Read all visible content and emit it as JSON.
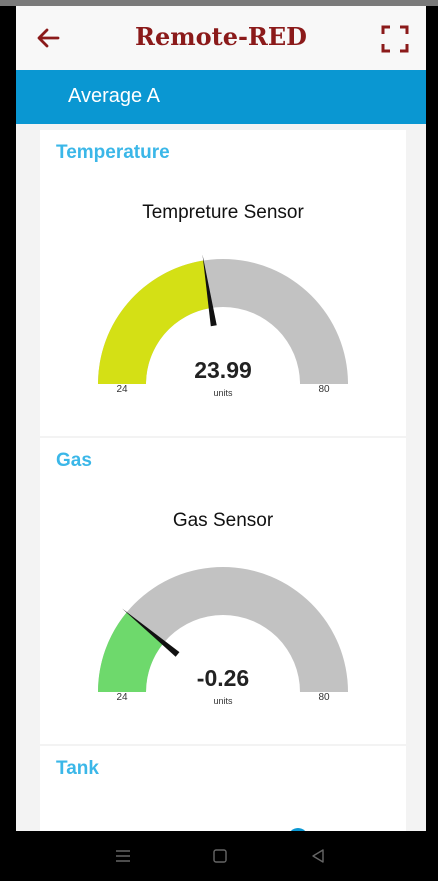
{
  "app": {
    "title": "Remote-RED"
  },
  "group": {
    "title": "Average A"
  },
  "cards": [
    {
      "label": "Temperature",
      "gauge": {
        "title": "Tempreture Sensor",
        "value": 23.99,
        "value_text": "23.99",
        "min": 24,
        "max": 80,
        "min_label": "24",
        "max_label": "80",
        "units": "units",
        "color": "#d4e015"
      }
    },
    {
      "label": "Gas",
      "gauge": {
        "title": "Gas Sensor",
        "value": -0.26,
        "value_text": "-0.26",
        "min": 24,
        "max": 80,
        "min_label": "24",
        "max_label": "80",
        "units": "units",
        "color": "#6ed96c"
      }
    },
    {
      "label": "Tank"
    }
  ],
  "colors": {
    "accent": "#0a97d2",
    "title_red": "#8b1a1a",
    "card_label": "#3bb7e8",
    "gauge_track": "#c2c2c2"
  }
}
